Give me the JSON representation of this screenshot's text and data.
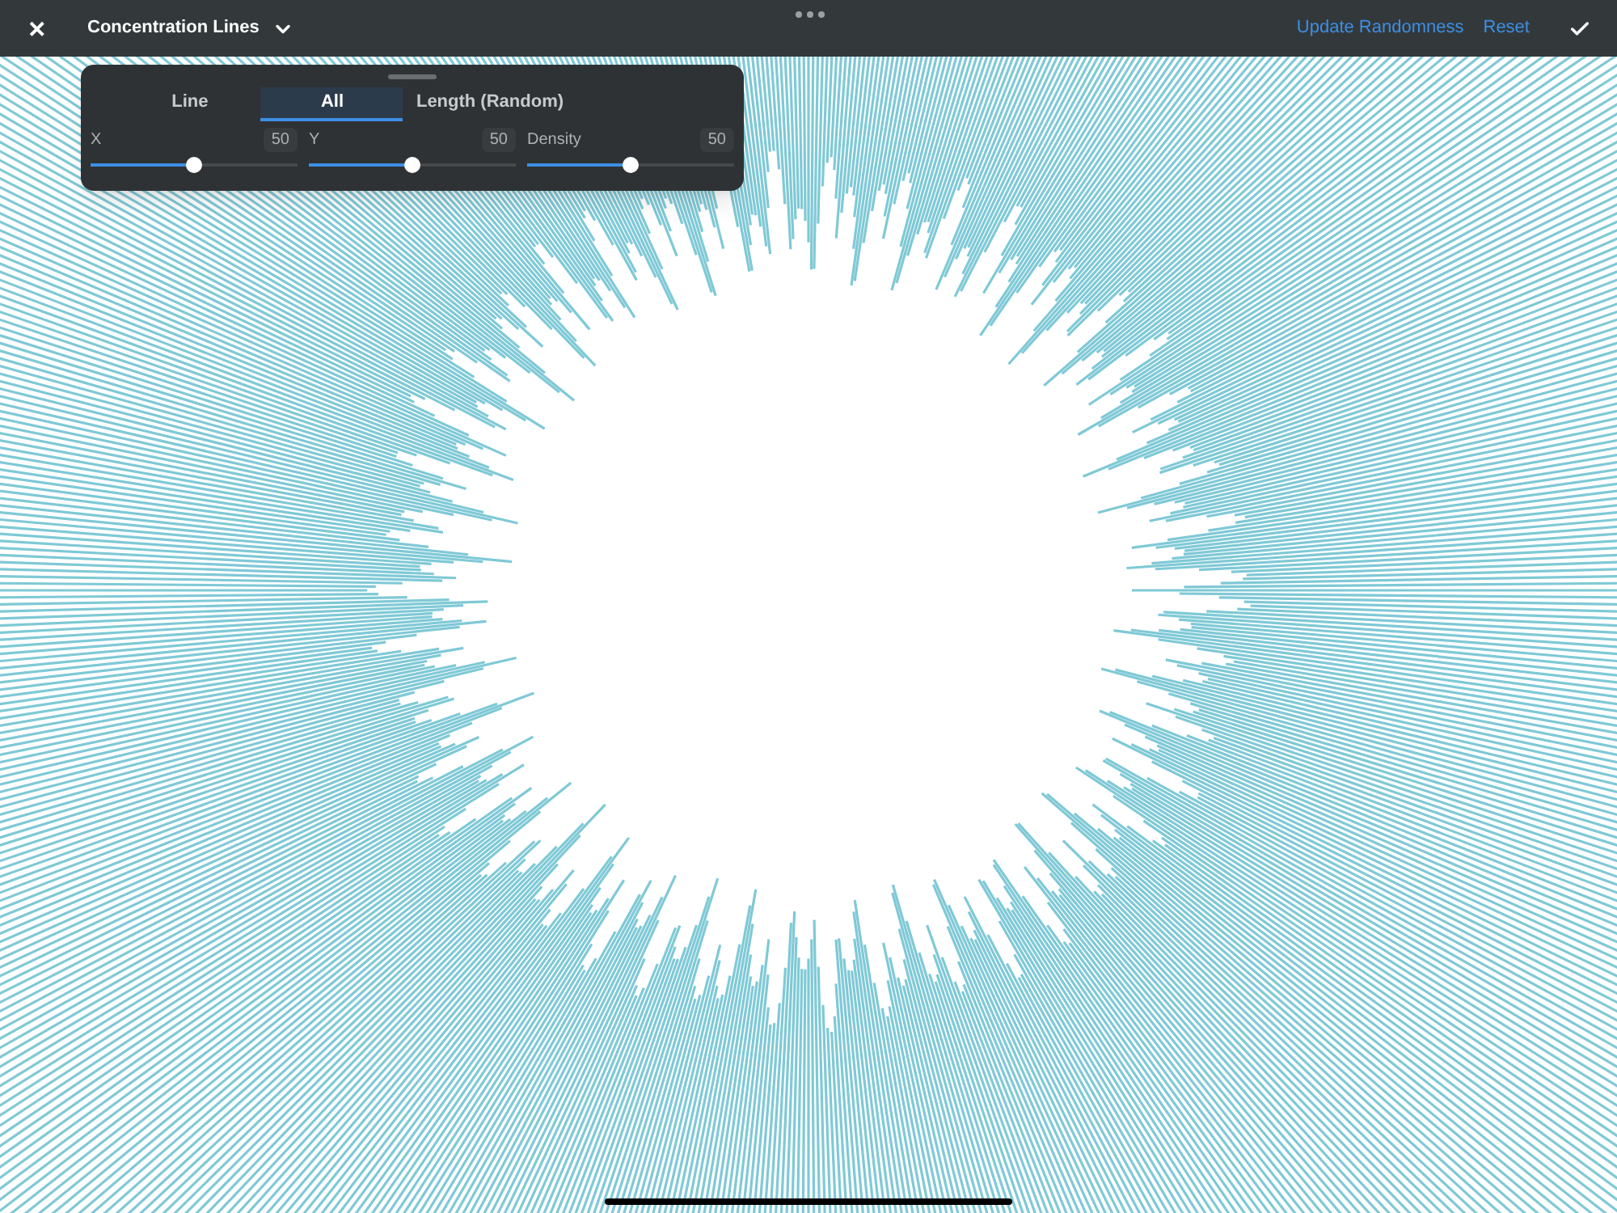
{
  "top_bar": {
    "close": "✕",
    "title": "Concentration Lines",
    "actions": [
      "Update Randomness",
      "Reset"
    ]
  },
  "panel": {
    "tabs": [
      {
        "label": "Line",
        "selected": false
      },
      {
        "label": "All",
        "selected": true
      },
      {
        "label": "Length (Random)",
        "selected": false
      }
    ],
    "sliders": [
      {
        "label": "X",
        "reading": "50",
        "level": 0.5
      },
      {
        "label": "Y",
        "reading": "50",
        "level": 0.5
      },
      {
        "label": "Density",
        "reading": "50",
        "level": 0.5
      }
    ]
  }
}
